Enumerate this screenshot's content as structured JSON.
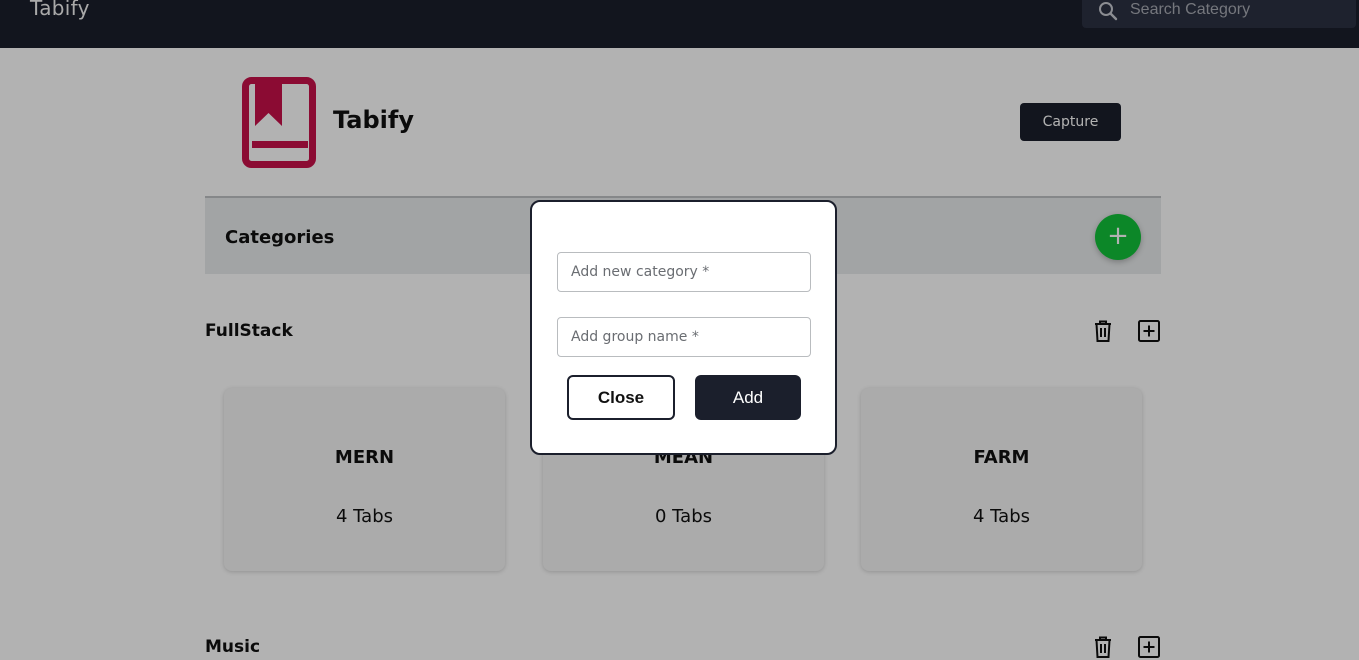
{
  "navbar": {
    "brand": "Tabify",
    "search_placeholder": "Search Category"
  },
  "header": {
    "title": "Tabify",
    "capture_label": "Capture",
    "logo_color": "#c8104a"
  },
  "categories": {
    "title": "Categories",
    "add_label": "+"
  },
  "groups": [
    {
      "name": "FullStack",
      "cards": [
        {
          "title": "MERN",
          "count": "4 Tabs"
        },
        {
          "title": "MEAN",
          "count": "0 Tabs"
        },
        {
          "title": "FARM",
          "count": "4 Tabs"
        }
      ]
    },
    {
      "name": "Music",
      "cards": []
    }
  ],
  "icons": {
    "search": "search-icon",
    "delete": "trash-icon",
    "add_group": "plus-square-icon"
  },
  "modal": {
    "category_placeholder": "Add new category *",
    "group_placeholder": "Add group name *",
    "close_label": "Close",
    "add_label": "Add"
  },
  "colors": {
    "navbar_bg": "#1b1f2c",
    "fab_green": "#12c23a",
    "logo_crimson": "#c8104a"
  }
}
